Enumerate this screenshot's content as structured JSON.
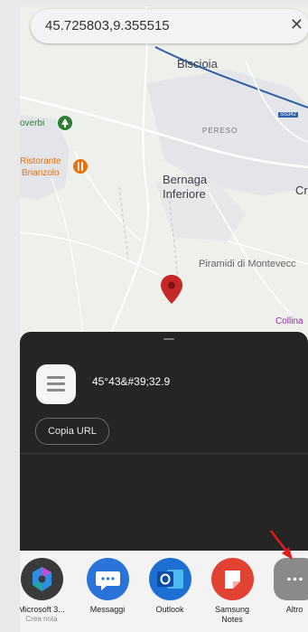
{
  "search": {
    "query": "45.725803,9.355515"
  },
  "map": {
    "places": {
      "biscioia": "Biscioia",
      "pereso": "PERESO",
      "overbi": "overbi",
      "ristorante": "Ristorante",
      "brianzolo": "Brianzolo",
      "bernaga": "Bernaga",
      "inferiore": "Inferiore",
      "cr": "Cr",
      "piramidi": "Piramidi di Montevecc",
      "collina": "Collina",
      "road": "SS342"
    },
    "pin_color": "#c62828"
  },
  "share": {
    "text": "45°43&#39;32.9",
    "copy_label": "Copia URL"
  },
  "apps": [
    {
      "label": "Microsoft 3...",
      "sub": "Crea nota",
      "icon": "microsoft-365-icon"
    },
    {
      "label": "Messaggi",
      "sub": "",
      "icon": "messages-icon"
    },
    {
      "label": "Outlook",
      "sub": "",
      "icon": "outlook-icon"
    },
    {
      "label": "Samsung",
      "sub": "Notes",
      "icon": "samsung-notes-icon"
    },
    {
      "label": "Altro",
      "sub": "",
      "icon": "more-icon"
    }
  ]
}
